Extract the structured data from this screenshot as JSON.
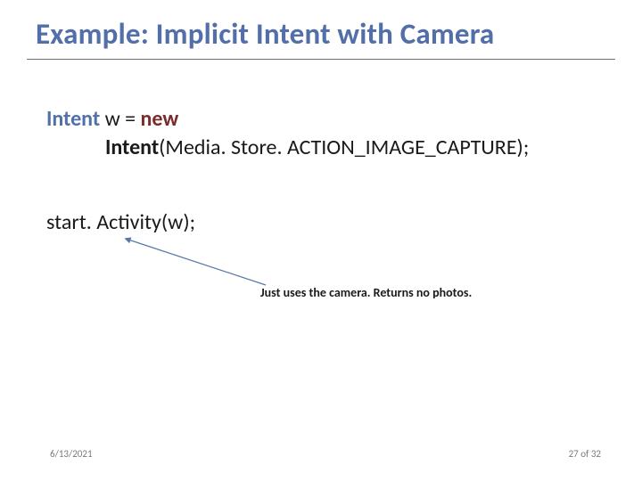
{
  "title": "Example: Implicit Intent with Camera",
  "code": {
    "type": "Intent",
    "var": " w = ",
    "newkw": "new",
    "ctor": "Intent",
    "args": "(Media. Store. ACTION_IMAGE_CAPTURE);"
  },
  "call": "start. Activity(w);",
  "annotation": "Just uses the camera. Returns no photos.",
  "footer": {
    "date": "6/13/2021",
    "page": "27 of 32"
  },
  "colors": {
    "title": "#526faa",
    "keyword_type": "#516fa8",
    "keyword_new": "#7b2b2a",
    "arrow": "#5a76a7"
  }
}
